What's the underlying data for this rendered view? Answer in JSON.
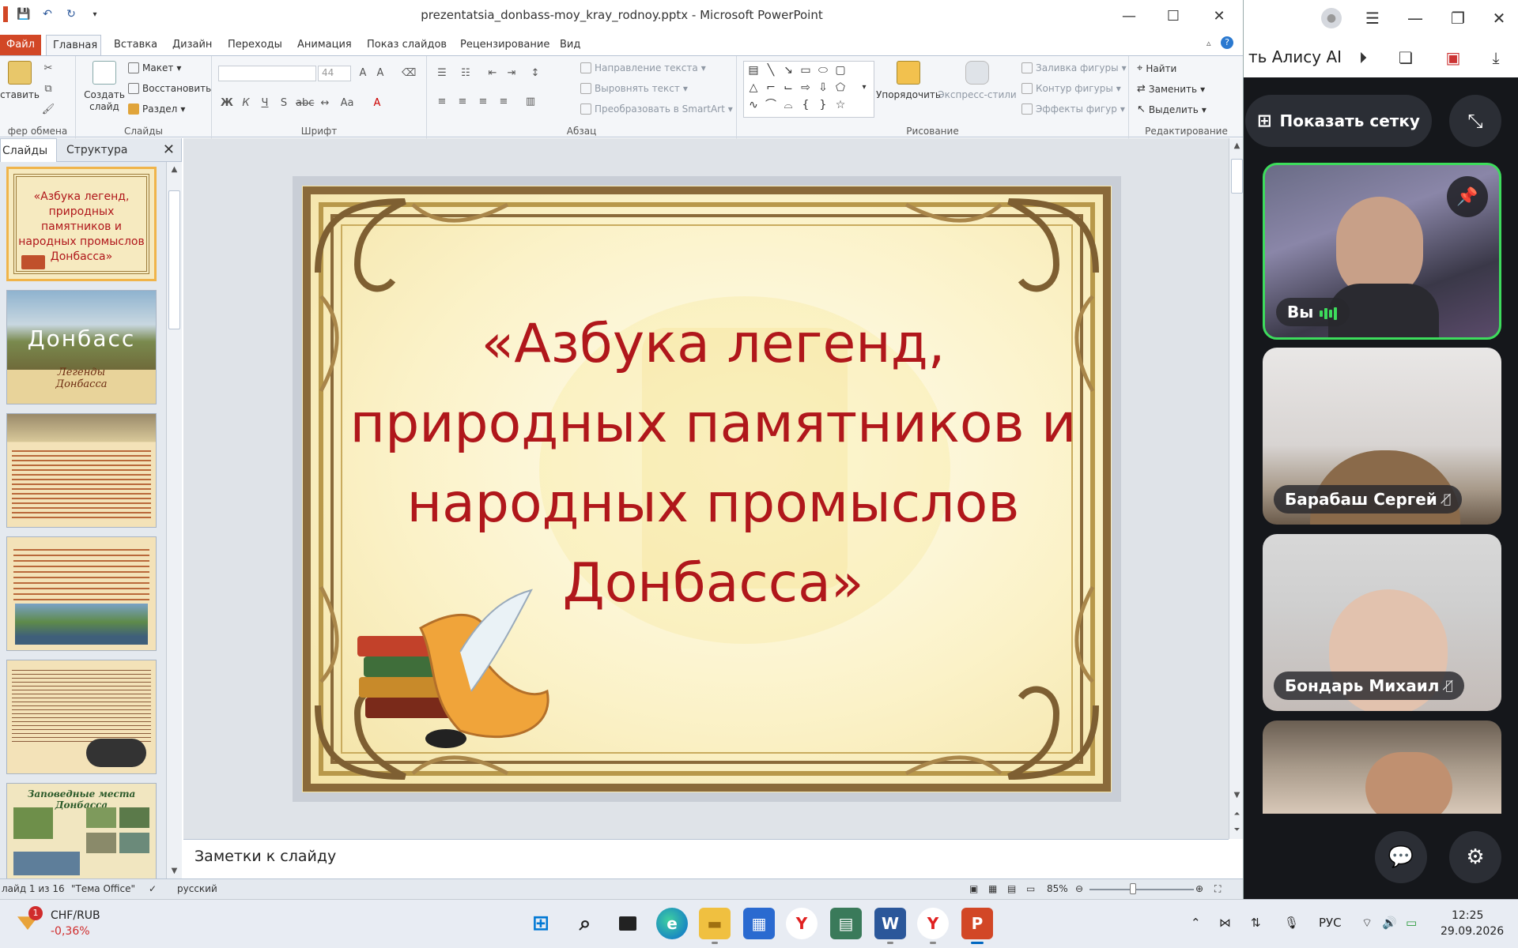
{
  "window": {
    "title": "prezentatsia_donbass-moy_kray_rodnoy.pptx - Microsoft PowerPoint",
    "minimize": "—",
    "maximize": "☐",
    "close": "✕"
  },
  "tabs": {
    "file": "Файл",
    "home": "Главная",
    "insert": "Вставка",
    "design": "Дизайн",
    "transitions": "Переходы",
    "animations": "Анимация",
    "slideshow": "Показ слайдов",
    "review": "Рецензирование",
    "view": "Вид"
  },
  "ribbon": {
    "clipboard": {
      "paste": "ставить",
      "label": "фер обмена"
    },
    "slides": {
      "new_slide": "Создать слайд",
      "layout": "Макет",
      "reset": "Восстановить",
      "section": "Раздел",
      "label": "Слайды"
    },
    "font": {
      "size": "44",
      "label": "Шрифт"
    },
    "paragraph": {
      "text_direction": "Направление текста",
      "align_text": "Выровнять текст",
      "smartart": "Преобразовать в SmartArt",
      "label": "Абзац"
    },
    "drawing": {
      "arrange": "Упорядочить",
      "quick_styles": "Экспресс-стили",
      "shape_fill": "Заливка фигуры",
      "shape_outline": "Контур фигуры",
      "shape_effects": "Эффекты фигур",
      "label": "Рисование"
    },
    "editing": {
      "find": "Найти",
      "replace": "Заменить",
      "select": "Выделить",
      "label": "Редактирование"
    }
  },
  "left_pane": {
    "tab_slides": "Слайды",
    "tab_outline": "Структура",
    "thumbs": [
      {
        "text": "«Азбука легенд, природных памятников и народных промыслов Донбасса»"
      },
      {
        "title": "Донбасс",
        "subtitle": "Легенды Донбасса"
      },
      {
        "text": ""
      },
      {
        "text": ""
      },
      {
        "text": ""
      },
      {
        "text": "Заповедные места Донбасса"
      }
    ]
  },
  "slide": {
    "title": "«Азбука легенд, природных памятников и народных промыслов Донбасса»"
  },
  "notes": {
    "placeholder": "Заметки к слайду"
  },
  "statusbar": {
    "slide_info": "лайд 1 из 16",
    "theme": "\"Тема Office\"",
    "language": "русский",
    "zoom": "85%",
    "zoom_value": 85
  },
  "meeting": {
    "top_text": "ть Алису AI",
    "show_grid": "Показать сетку",
    "participants": [
      {
        "name": "Вы",
        "mic": "on"
      },
      {
        "name": "Барабаш Сергей",
        "mic": "off"
      },
      {
        "name": "Бондарь Михаил",
        "mic": "off"
      },
      {
        "name": "",
        "mic": "off"
      }
    ]
  },
  "taskbar": {
    "widget_title": "CHF/RUB",
    "widget_value": "-0,36%",
    "widget_badge": "1",
    "language": "РУС",
    "time": "12:25",
    "date": "29.09.2026"
  },
  "colors": {
    "slide_title": "#b0171b",
    "file_tab": "#d24726",
    "meeting_bg": "#15171b"
  }
}
